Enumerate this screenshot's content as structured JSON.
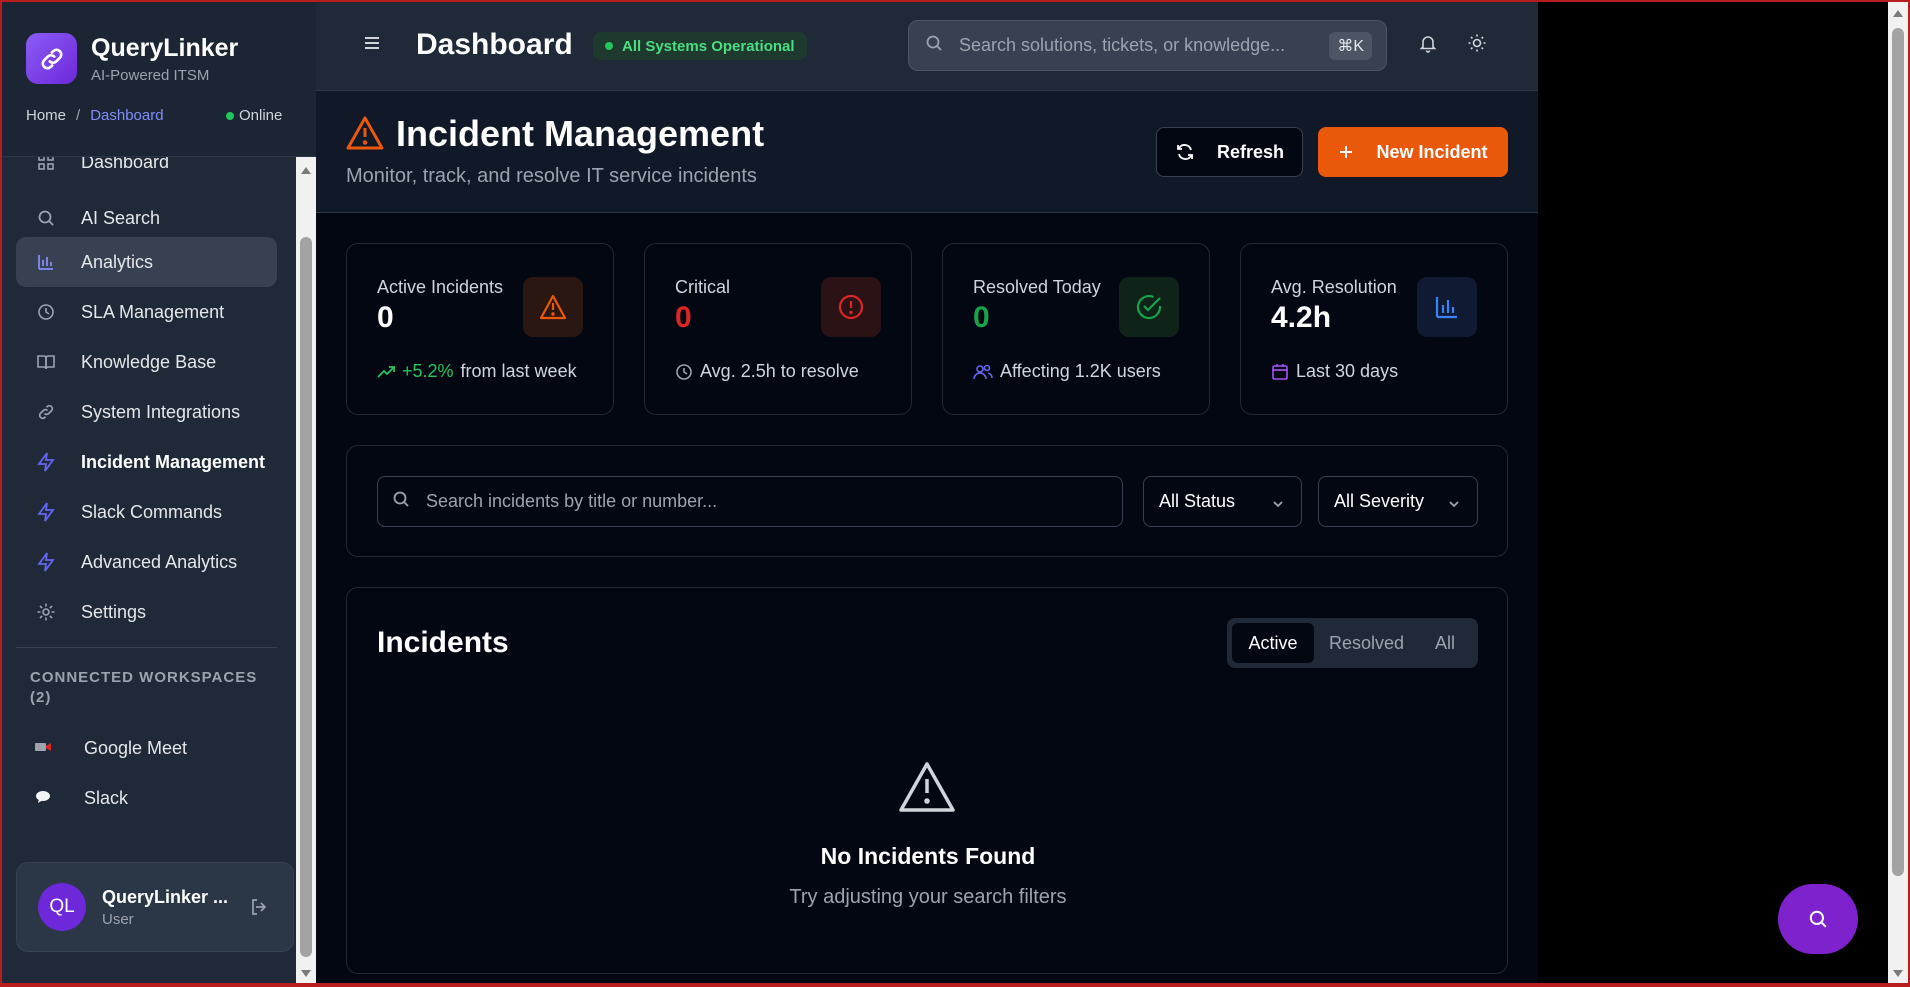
{
  "app": {
    "name": "QueryLinker",
    "tagline": "AI-Powered ITSM"
  },
  "breadcrumb": {
    "home": "Home",
    "sep": "/",
    "current": "Dashboard"
  },
  "connection": {
    "status": "Online"
  },
  "sidebar": {
    "items": [
      {
        "label": "Dashboard",
        "icon": "grid-icon"
      },
      {
        "label": "AI Search",
        "icon": "search-icon"
      },
      {
        "label": "Analytics",
        "icon": "bar-chart-icon",
        "selected": true
      },
      {
        "label": "SLA Management",
        "icon": "clock-icon"
      },
      {
        "label": "Knowledge Base",
        "icon": "book-icon"
      },
      {
        "label": "System Integrations",
        "icon": "link-icon"
      },
      {
        "label": "Incident Management",
        "icon": "zap-icon"
      },
      {
        "label": "Slack Commands",
        "icon": "zap-icon"
      },
      {
        "label": "Advanced Analytics",
        "icon": "zap-icon"
      },
      {
        "label": "Settings",
        "icon": "gear-icon"
      }
    ],
    "workspaces_title": "CONNECTED WORKSPACES (2)",
    "workspaces": [
      {
        "label": "Google Meet",
        "icon": "camera-icon"
      },
      {
        "label": "Slack",
        "icon": "chat-bubble-icon"
      }
    ]
  },
  "user": {
    "initials": "QL",
    "name": "QueryLinker ...",
    "role": "User"
  },
  "topbar": {
    "title": "Dashboard",
    "status": "All Systems Operational",
    "search_placeholder": "Search solutions, tickets, or knowledge...",
    "shortcut": "⌘K"
  },
  "page": {
    "title": "Incident Management",
    "subtitle": "Monitor, track, and resolve IT service incidents",
    "refresh_label": "Refresh",
    "new_label": "New Incident"
  },
  "stats": [
    {
      "label": "Active Incidents",
      "value": "0",
      "trend": "+5.2%",
      "foot": "from last week",
      "color": "#ffffff",
      "icon": "warning-triangle-icon"
    },
    {
      "label": "Critical",
      "value": "0",
      "foot": "Avg. 2.5h to resolve",
      "color": "#dc2626",
      "icon": "alert-circle-icon"
    },
    {
      "label": "Resolved Today",
      "value": "0",
      "foot": "Affecting 1.2K users",
      "color": "#16a34a",
      "icon": "check-circle-icon"
    },
    {
      "label": "Avg. Resolution",
      "value": "4.2h",
      "foot": "Last 30 days",
      "color": "#ffffff",
      "icon": "bar-chart-icon"
    }
  ],
  "filters": {
    "search_placeholder": "Search incidents by title or number...",
    "status": "All Status",
    "severity": "All Severity"
  },
  "incidents": {
    "title": "Incidents",
    "tabs": [
      "Active",
      "Resolved",
      "All"
    ],
    "active_tab": "Active",
    "empty_title": "No Incidents Found",
    "empty_sub": "Try adjusting your search filters"
  },
  "colors": {
    "accent": "#ea580c",
    "brand": "#7c3aed",
    "success": "#22c55e",
    "danger": "#dc2626",
    "info": "#6366f1"
  }
}
